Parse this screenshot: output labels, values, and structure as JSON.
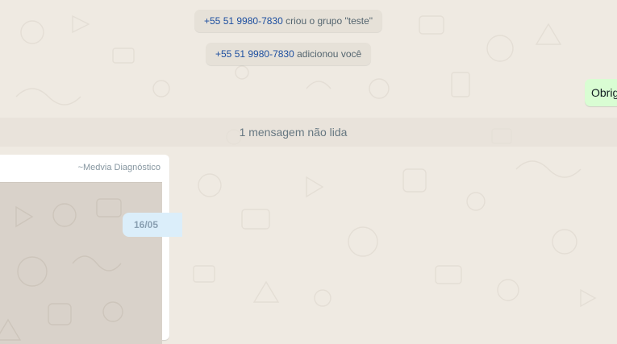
{
  "chat": {
    "system_messages": [
      {
        "phone": "+55 51 9980-7830",
        "text": "criou o grupo \"teste\""
      },
      {
        "phone": "+55 51 9980-7830",
        "text": "adicionou você"
      }
    ],
    "outgoing_preview_text": "Obrigado",
    "unread_divider_text": "1 mensagem não lida",
    "incoming_message": {
      "sender": "~Medvia Diagnóstico",
      "inner_timestamp_preview": "16/05"
    }
  },
  "colors": {
    "wallpaper": "#efeae2",
    "outgoing_bubble": "#d9fdd3",
    "system_bubble": "#e6e1d8",
    "phone_link": "#1d4fa0"
  }
}
